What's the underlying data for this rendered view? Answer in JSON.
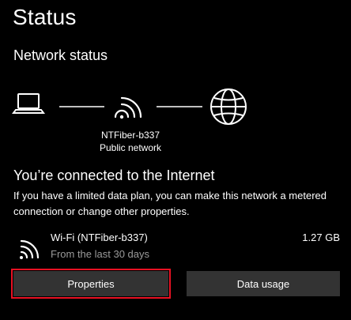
{
  "page": {
    "title": "Status"
  },
  "network_status": {
    "title": "Network status",
    "network_name": "NTFiber-b337",
    "network_type": "Public network"
  },
  "connection": {
    "title": "You’re connected to the Internet",
    "description": "If you have a limited data plan, you can make this network a metered connection or change other properties."
  },
  "usage": {
    "adapter_label": "Wi-Fi (NTFiber-b337)",
    "period": "From the last 30 days",
    "amount": "1.27 GB"
  },
  "buttons": {
    "properties": "Properties",
    "data_usage": "Data usage"
  },
  "icons": {
    "device": "laptop-icon",
    "network": "wifi-icon",
    "internet": "globe-icon"
  },
  "colors": {
    "background": "#000000",
    "button": "#333333",
    "highlight_border": "#e81123",
    "secondary_text": "#9a9a9a"
  }
}
